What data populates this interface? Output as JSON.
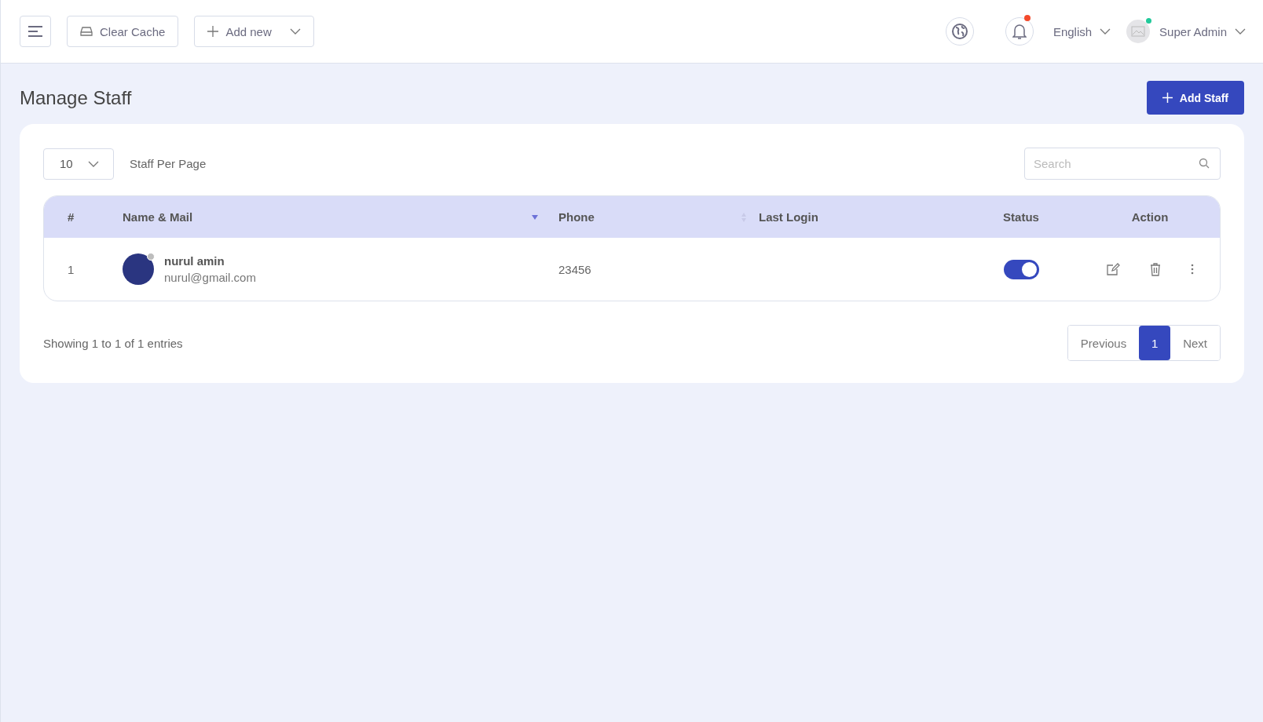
{
  "topbar": {
    "clear_cache": "Clear Cache",
    "add_new": "Add new",
    "notifications_unread": true,
    "language": "English",
    "user": {
      "name": "Super Admin",
      "online": true
    }
  },
  "page_title": "Manage Staff",
  "add_button": "Add Staff",
  "per_page": {
    "value": "10",
    "label": "Staff Per Page"
  },
  "search": {
    "placeholder": "Search"
  },
  "table": {
    "columns": [
      {
        "label": "#",
        "kind": "plain"
      },
      {
        "label": "Name & Mail",
        "kind": "sorted"
      },
      {
        "label": "Phone",
        "kind": "sortable"
      },
      {
        "label": "Last Login",
        "kind": "plain"
      },
      {
        "label": "Status",
        "kind": "plain"
      },
      {
        "label": "Action",
        "kind": "plain"
      }
    ],
    "rows": [
      {
        "index": "1",
        "name": "nurul amin",
        "email": "nurul@gmail.com",
        "online": false,
        "phone": "23456",
        "active": true
      }
    ]
  },
  "footer": {
    "summary": "Showing 1 to 1 of 1 entries",
    "pages": [
      {
        "kind": "prev",
        "label": "Previous",
        "selected": false
      },
      {
        "kind": "page",
        "label": "1",
        "selected": true
      },
      {
        "kind": "next",
        "label": "Next",
        "selected": false
      }
    ]
  }
}
